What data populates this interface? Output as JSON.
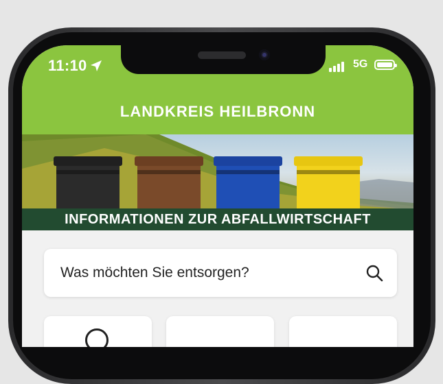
{
  "status_bar": {
    "time": "11:10",
    "network": "5G"
  },
  "header": {
    "title": "LANDKREIS HEILBRONN"
  },
  "banner": {
    "caption": "INFORMATIONEN ZUR ABFALLWIRTSCHAFT"
  },
  "search": {
    "placeholder": "Was möchten Sie entsorgen?"
  },
  "colors": {
    "brand_green": "#8bc53f",
    "banner_caption_bg": "#224b30",
    "bin_black": "#2b2b2b",
    "bin_brown": "#7a4a2a",
    "bin_blue": "#1f4fb5",
    "bin_yellow": "#f2d21c"
  },
  "icons": {
    "location": "location-arrow-icon",
    "search": "search-icon"
  }
}
